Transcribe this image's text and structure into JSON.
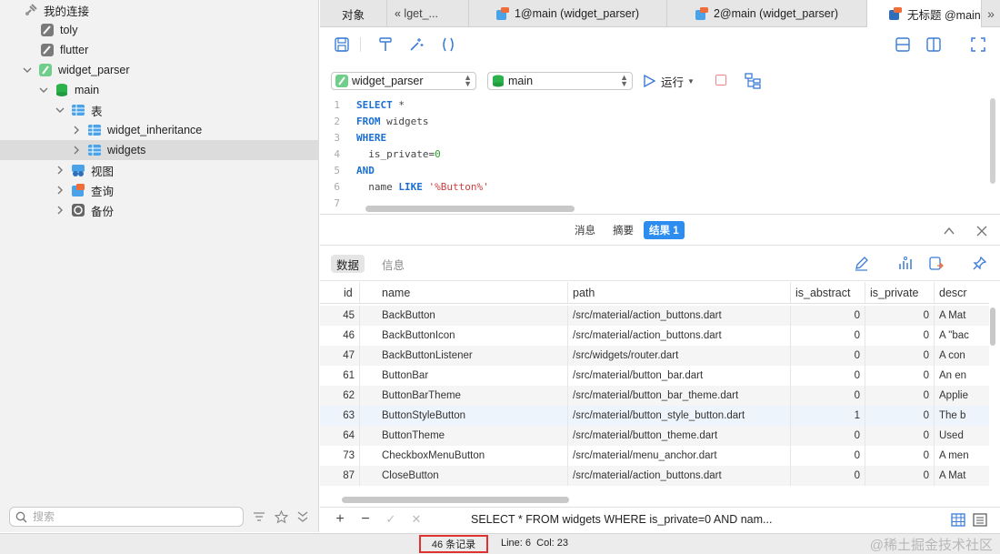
{
  "sidebar": {
    "tree": [
      {
        "label": "我的连接",
        "icon": "connections-icon"
      },
      {
        "label": "toly",
        "icon": "db-connection-icon"
      },
      {
        "label": "flutter",
        "icon": "db-connection-icon"
      },
      {
        "label": "widget_parser",
        "icon": "sqlite-connection-icon"
      },
      {
        "label": "main",
        "icon": "database-icon"
      },
      {
        "label": "表",
        "icon": "tables-folder-icon"
      },
      {
        "label": "widget_inheritance",
        "icon": "table-icon"
      },
      {
        "label": "widgets",
        "icon": "table-icon"
      },
      {
        "label": "视图",
        "icon": "views-icon"
      },
      {
        "label": "查询",
        "icon": "queries-icon"
      },
      {
        "label": "备份",
        "icon": "backup-icon"
      }
    ],
    "search_placeholder": "搜索"
  },
  "tabs": [
    {
      "label": "对象"
    },
    {
      "label": "«  lget_..."
    },
    {
      "label": "1@main (widget_parser)"
    },
    {
      "label": "2@main (widget_parser)"
    },
    {
      "label": "无标题 @main"
    }
  ],
  "tabs_overflow": "»",
  "editor": {
    "connection": "widget_parser",
    "database": "main",
    "run_label": "运行",
    "lines": [
      "1",
      "2",
      "3",
      "4",
      "5",
      "6",
      "7"
    ]
  },
  "result_tabs": [
    "消息",
    "摘要",
    "结果 1"
  ],
  "data_tabs": [
    "数据",
    "信息"
  ],
  "grid": {
    "columns": [
      "id",
      "name",
      "path",
      "is_abstract",
      "is_private",
      "descr"
    ],
    "rows": [
      [
        "45",
        "BackButton",
        "/src/material/action_buttons.dart",
        "0",
        "0",
        "A Mat"
      ],
      [
        "46",
        "BackButtonIcon",
        "/src/material/action_buttons.dart",
        "0",
        "0",
        "A \"bac"
      ],
      [
        "47",
        "BackButtonListener",
        "/src/widgets/router.dart",
        "0",
        "0",
        "A con"
      ],
      [
        "61",
        "ButtonBar",
        "/src/material/button_bar.dart",
        "0",
        "0",
        "An en"
      ],
      [
        "62",
        "ButtonBarTheme",
        "/src/material/button_bar_theme.dart",
        "0",
        "0",
        "Applie"
      ],
      [
        "63",
        "ButtonStyleButton",
        "/src/material/button_style_button.dart",
        "1",
        "0",
        "The b"
      ],
      [
        "64",
        "ButtonTheme",
        "/src/material/button_theme.dart",
        "0",
        "0",
        "Used"
      ],
      [
        "73",
        "CheckboxMenuButton",
        "/src/material/menu_anchor.dart",
        "0",
        "0",
        "A men"
      ],
      [
        "87",
        "CloseButton",
        "/src/material/action_buttons.dart",
        "0",
        "0",
        "A Mat"
      ]
    ]
  },
  "footer": {
    "add": "+",
    "remove": "−",
    "apply": "✓",
    "discard": "✕",
    "sql_preview": "SELECT * FROM widgets WHERE  is_private=0  AND nam..."
  },
  "status": {
    "record_count": "46 条记录",
    "line": "Line: 6",
    "col": "Col: 23",
    "watermark": "@稀土掘金技术社区"
  },
  "colors": {
    "accent": "#2d8cf0",
    "record_highlight": "#e03030"
  }
}
